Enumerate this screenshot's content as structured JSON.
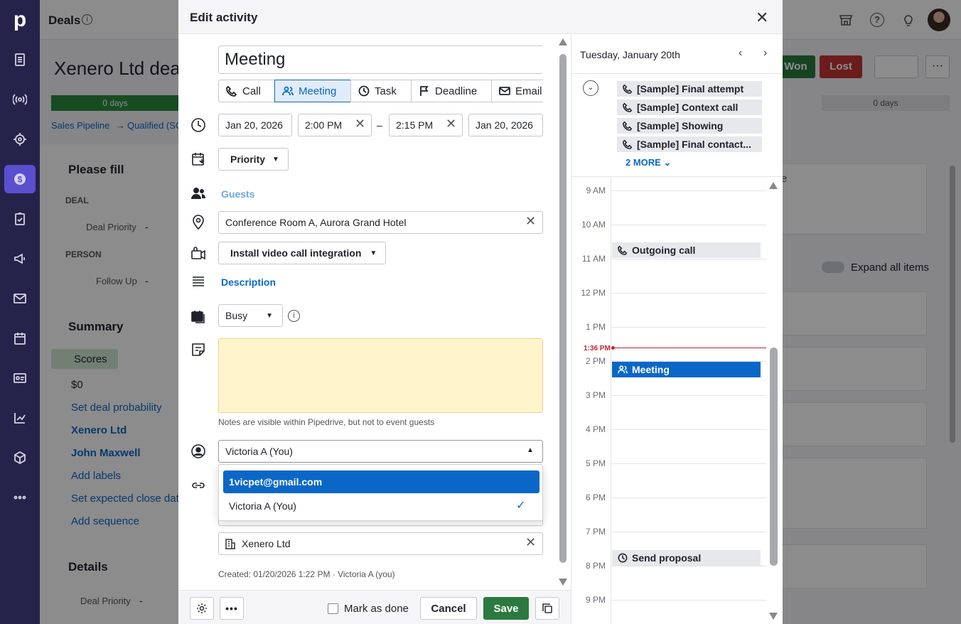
{
  "app": {
    "page_title": "Deals",
    "deal_title": "Xenero Ltd dea",
    "won_label": "Won",
    "lost_label": "Lost",
    "days_1": "0 days",
    "days_2": "0 days",
    "breadcrumb_pipeline": "Sales Pipeline",
    "breadcrumb_stage": "Qualified (SC"
  },
  "sidebar": {
    "please_fill": "Please fill",
    "deal_header": "DEAL",
    "deal_priority_label": "Deal Priority",
    "deal_priority_value": "-",
    "person_header": "PERSON",
    "follow_up_label": "Follow Up",
    "follow_up_value": "-",
    "summary": "Summary",
    "scores": "Scores",
    "amount": "$0",
    "set_probability": "Set deal probability",
    "org": "Xenero Ltd",
    "person": "John Maxwell",
    "add_labels": "Add labels",
    "set_close_date": "Set expected close dat",
    "add_sequence": "Add sequence",
    "details": "Details",
    "details_priority_label": "Deal Priority",
    "details_priority_value": "-"
  },
  "right_panel": {
    "expand_all": "Expand all items",
    "fragment": "e"
  },
  "modal": {
    "title": "Edit activity",
    "subject": "Meeting",
    "types": [
      {
        "label": "Call"
      },
      {
        "label": "Meeting"
      },
      {
        "label": "Task"
      },
      {
        "label": "Deadline"
      },
      {
        "label": "Email"
      }
    ],
    "start_date": "Jan 20, 2026",
    "start_time": "2:00 PM",
    "dash": "–",
    "end_time": "2:15 PM",
    "end_date": "Jan 20, 2026",
    "priority": "Priority",
    "guests": "Guests",
    "location": "Conference Room A, Aurora Grand Hotel",
    "video_call": "Install video call integration",
    "description": "Description",
    "busy": "Busy",
    "notes_hint": "Notes are visible within Pipedrive, but not to event guests",
    "owner": "Victoria A (You)",
    "dropdown_options": [
      {
        "label": "1vicpet@gmail.com",
        "selected": false
      },
      {
        "label": "Victoria A (You)",
        "selected": true
      }
    ],
    "organization": "Xenero Ltd",
    "created": "Created: 01/20/2026 1:22 PM · Victoria A (you)",
    "mark_done": "Mark as done",
    "cancel": "Cancel",
    "save": "Save"
  },
  "calendar": {
    "date": "Tuesday, January 20th",
    "all_day": [
      "[Sample] Final attempt",
      "[Sample] Context call",
      "[Sample] Showing",
      "[Sample] Final contact..."
    ],
    "more": "2 MORE",
    "hours": [
      "9 AM",
      "10 AM",
      "11 AM",
      "12 PM",
      "1 PM",
      "2 PM",
      "3 PM",
      "4 PM",
      "5 PM",
      "6 PM",
      "7 PM",
      "8 PM",
      "9 PM"
    ],
    "now": "1:36 PM",
    "events": {
      "outgoing": "Outgoing call",
      "meeting": "Meeting",
      "proposal": "Send proposal"
    }
  },
  "colors": {
    "nav": "#26234a",
    "accent_blue": "#0b67c7",
    "save_green": "#2a7a3f",
    "lost_red": "#c43434",
    "notes_bg": "#fff4cc",
    "now_line": "#c0262d"
  }
}
